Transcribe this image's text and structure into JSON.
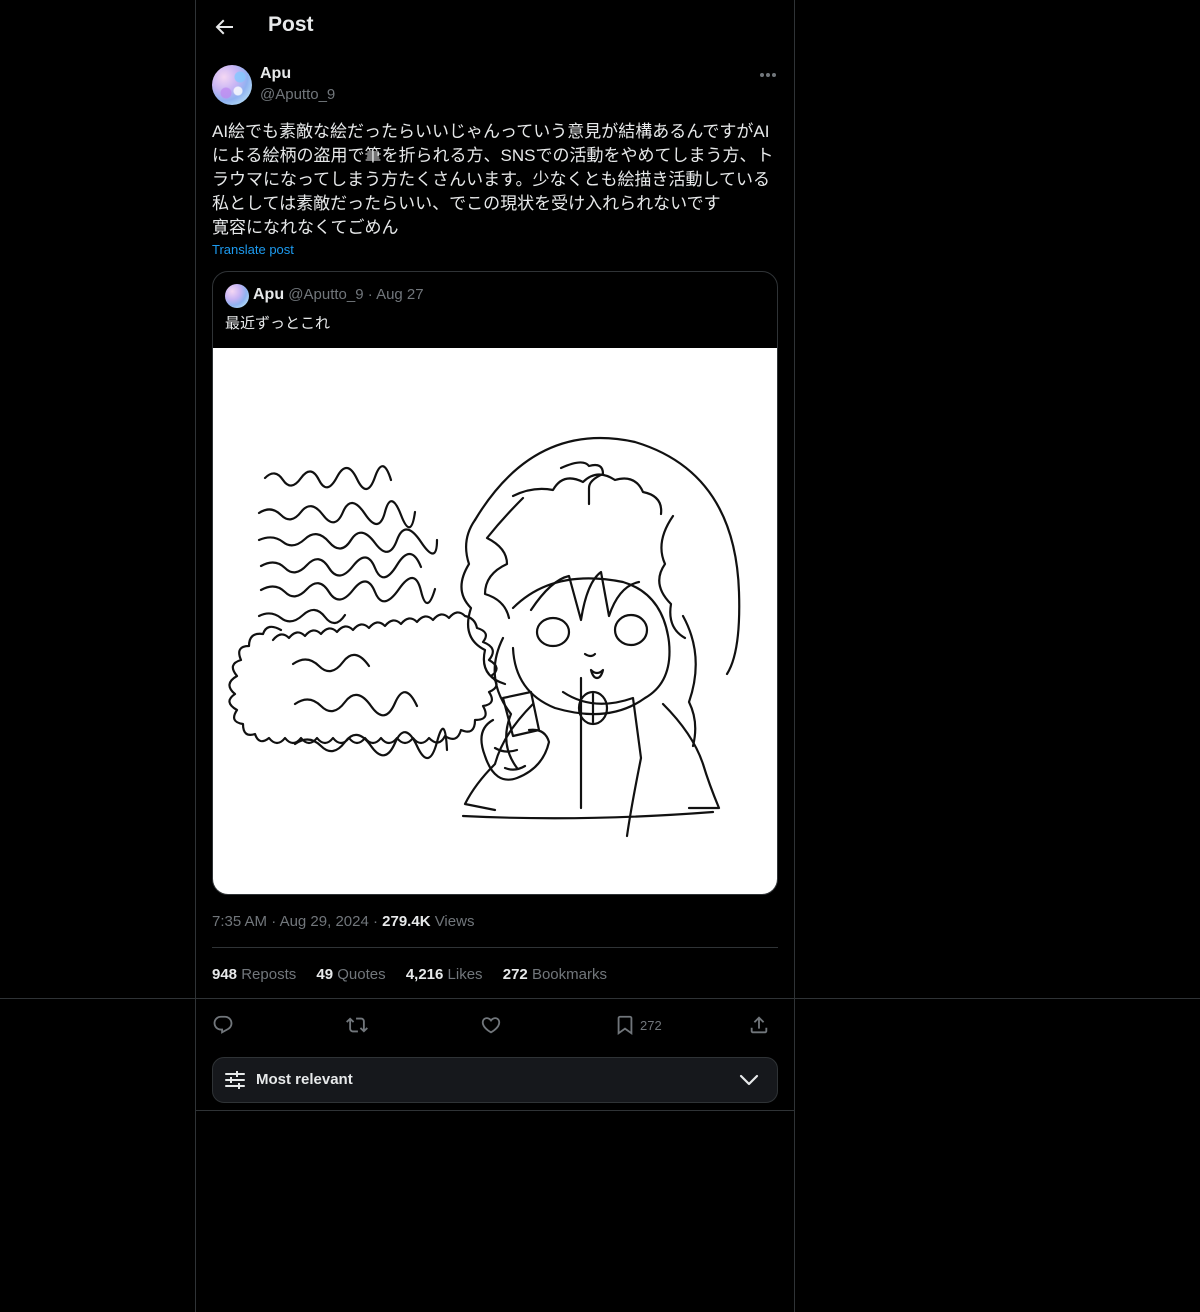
{
  "header": {
    "title": "Post"
  },
  "post": {
    "author_name": "Apu",
    "author_handle": "@Aputto_9",
    "text": "AI絵でも素敵な絵だったらいいじゃんっていう意見が結構あるんですがAI\nによる絵柄の盗用で筆を折られる方、SNSでの活動をやめてしまう方、ト\nラウマになってしまう方たくさんいます。少なくとも絵描き活動している\n私としては素敵だったらいい、でこの現状を受け入れられないです\n寛容になれなくてごめん",
    "translate_label": "Translate post",
    "time": "7:35 AM",
    "date": "Aug 29, 2024",
    "views_count": "279.4K",
    "views_label": "Views"
  },
  "quote": {
    "author_name": "Apu",
    "author_handle": "@Aputto_9",
    "date": "Aug 27",
    "text": "最近ずっとこれ"
  },
  "stats": {
    "reposts_count": "948",
    "reposts_label": "Reposts",
    "quotes_count": "49",
    "quotes_label": "Quotes",
    "likes_count": "4,216",
    "likes_label": "Likes",
    "bookmarks_count": "272",
    "bookmarks_label": "Bookmarks"
  },
  "actions": {
    "reply_icon": "reply-icon",
    "repost_icon": "repost-icon",
    "like_icon": "like-icon",
    "bookmark_icon": "bookmark-icon",
    "bookmark_count": "272",
    "share_icon": "share-icon"
  },
  "sort": {
    "label": "Most relevant"
  },
  "colors": {
    "background": "#000000",
    "text": "#e7e9ea",
    "muted": "#71767b",
    "link": "#1d9bf0",
    "border": "#2f3336"
  }
}
